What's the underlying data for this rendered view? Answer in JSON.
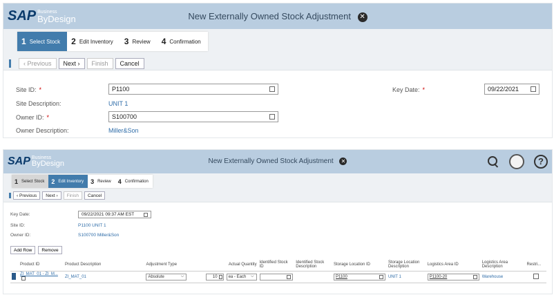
{
  "brand": {
    "sap": "SAP",
    "business": "Business",
    "bydesign": "ByDesign"
  },
  "top": {
    "title": "New Externally Owned Stock Adjustment",
    "steps": [
      {
        "num": "1",
        "label": "Select Stock"
      },
      {
        "num": "2",
        "label": "Edit Inventory"
      },
      {
        "num": "3",
        "label": "Review"
      },
      {
        "num": "4",
        "label": "Confirmation"
      }
    ],
    "toolbar": {
      "previous": "Previous",
      "next": "Next",
      "finish": "Finish",
      "cancel": "Cancel"
    },
    "site_id_label": "Site ID:",
    "site_id_value": "P1100",
    "site_desc_label": "Site Description:",
    "site_desc_value": "UNIT 1",
    "owner_id_label": "Owner ID:",
    "owner_id_value": "S100700",
    "owner_desc_label": "Owner Description:",
    "owner_desc_value": "Miller&Son",
    "key_date_label": "Key Date:",
    "key_date_value": "09/22/2021"
  },
  "bottom": {
    "title": "New Externally Owned Stock Adjustment",
    "steps": [
      {
        "num": "1",
        "label": "Select Stock"
      },
      {
        "num": "2",
        "label": "Edit Inventory"
      },
      {
        "num": "3",
        "label": "Review"
      },
      {
        "num": "4",
        "label": "Confirmation"
      }
    ],
    "toolbar": {
      "previous": "Previous",
      "next": "Next",
      "finish": "Finish",
      "cancel": "Cancel"
    },
    "key_date_label": "Key Date:",
    "key_date_value": "09/22/2021 09:37 AM EST",
    "site_id_label": "Site ID:",
    "site_id_value": "P1100 UNIT 1",
    "owner_id_label": "Owner ID:",
    "owner_id_value": "S100700 Miller&Son",
    "add_row": "Add Row",
    "remove": "Remove",
    "columns": {
      "product_id": "Product ID",
      "product_desc": "Product Description",
      "adj_type": "Adjustment Type",
      "actual_qty": "Actual Quantity",
      "ident_stock_id": "Identified Stock ID",
      "ident_stock_desc": "Identified Stock Description",
      "storage_loc_id": "Storage Location ID",
      "storage_loc_desc": "Storage Location Description",
      "log_area_id": "Logistics Area ID",
      "log_area_desc": "Logistics Area Description",
      "restri": "Restri..."
    },
    "row": {
      "product_id": "ZI_MAT_01 - ZI_M...",
      "product_desc": "ZI_MAT_01",
      "adj_type": "Absolute",
      "qty": "10",
      "uom": "ea - Each",
      "storage_loc_id": "P1100",
      "storage_loc_desc": "UNIT 1",
      "log_area_id": "P1100-20",
      "log_area_desc": "Warehouse"
    }
  },
  "icons": {
    "close": "close-icon",
    "search": "search-icon",
    "user": "user-icon",
    "help": "help-icon",
    "value_help": "value-help-icon",
    "calendar": "calendar-icon",
    "dropdown": "chevron-down-icon"
  },
  "colors": {
    "shell": "#b9cde0",
    "active_step": "#427cac",
    "link": "#2e6ca8",
    "required": "#cc0000"
  }
}
